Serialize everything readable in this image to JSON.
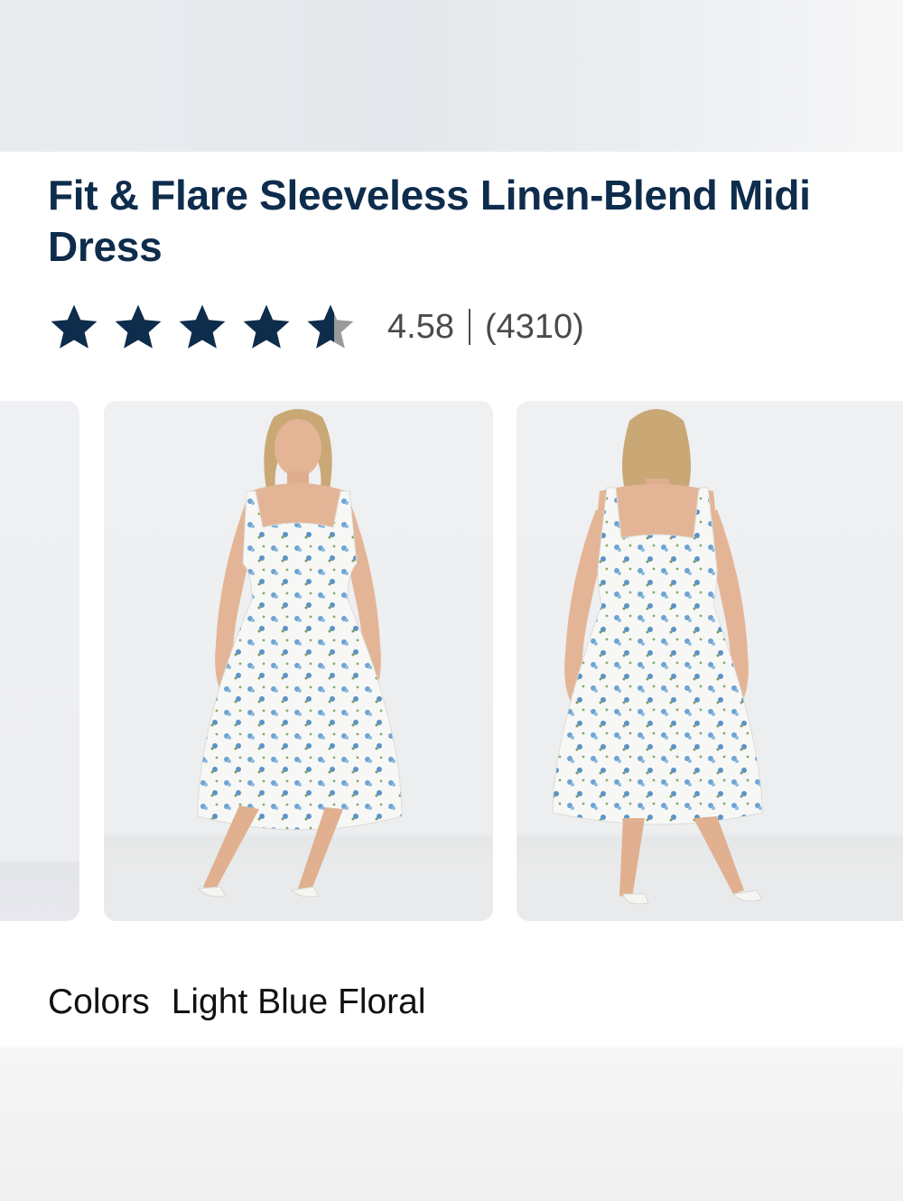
{
  "product": {
    "title": "Fit & Flare Sleeveless Linen-Blend Midi Dress",
    "rating": 4.58,
    "rating_display": "4.58",
    "review_count_display": "(4310)",
    "stars": {
      "max": 5,
      "filled": 4,
      "partial": 0.58
    }
  },
  "gallery": {
    "images": [
      {
        "name": "previous-image",
        "visible": "partial"
      },
      {
        "name": "front-view-image"
      },
      {
        "name": "back-view-image"
      }
    ]
  },
  "colors": {
    "label": "Colors",
    "selected": "Light Blue Floral"
  },
  "theme": {
    "brand_navy": "#0e2c4c",
    "star_empty": "#9a9a9a",
    "text_gray": "#4a4a4a",
    "dress_base": "#f7f8f6",
    "floral_blue": "#6ea4d4"
  }
}
